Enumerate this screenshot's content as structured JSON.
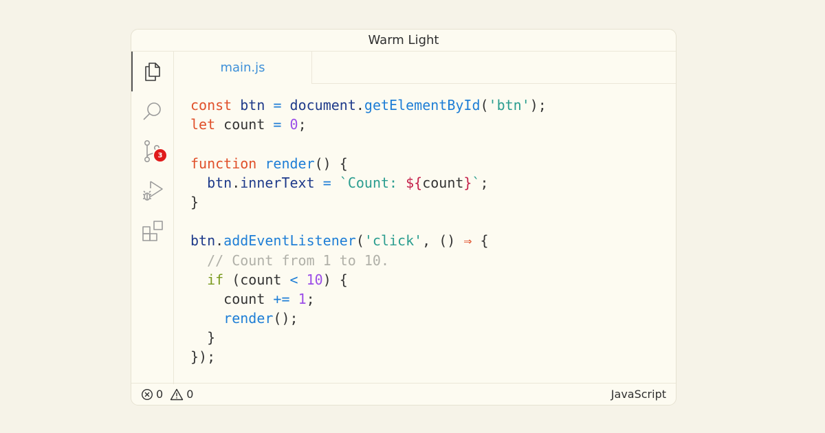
{
  "window": {
    "title": "Warm Light"
  },
  "tabs": [
    {
      "label": "main.js",
      "active": true
    }
  ],
  "activity_bar": {
    "items": [
      {
        "icon": "files-icon",
        "active": true
      },
      {
        "icon": "search-icon",
        "active": false
      },
      {
        "icon": "source-control-icon",
        "active": false,
        "badge": "3"
      },
      {
        "icon": "run-debug-icon",
        "active": false
      },
      {
        "icon": "extensions-icon",
        "active": false
      }
    ]
  },
  "code": {
    "language": "javascript",
    "lines": [
      [
        [
          "kw",
          "const"
        ],
        [
          "p",
          " "
        ],
        [
          "var",
          "btn"
        ],
        [
          "p",
          " "
        ],
        [
          "op",
          "="
        ],
        [
          "p",
          " "
        ],
        [
          "var",
          "document"
        ],
        [
          "p",
          "."
        ],
        [
          "fn",
          "getElementById"
        ],
        [
          "p",
          "("
        ],
        [
          "str",
          "'btn'"
        ],
        [
          "p",
          ");"
        ]
      ],
      [
        [
          "kw",
          "let"
        ],
        [
          "p",
          " count "
        ],
        [
          "op",
          "="
        ],
        [
          "p",
          " "
        ],
        [
          "num",
          "0"
        ],
        [
          "p",
          ";"
        ]
      ],
      [],
      [
        [
          "kw",
          "function"
        ],
        [
          "p",
          " "
        ],
        [
          "fn",
          "render"
        ],
        [
          "p",
          "() {"
        ]
      ],
      [
        [
          "p",
          "  "
        ],
        [
          "var",
          "btn"
        ],
        [
          "p",
          "."
        ],
        [
          "var",
          "innerText"
        ],
        [
          "p",
          " "
        ],
        [
          "op",
          "="
        ],
        [
          "p",
          " "
        ],
        [
          "str",
          "`Count: "
        ],
        [
          "interp",
          "${"
        ],
        [
          "p",
          "count"
        ],
        [
          "interp",
          "}"
        ],
        [
          "str",
          "`"
        ],
        [
          "p",
          ";"
        ]
      ],
      [
        [
          "p",
          "}"
        ]
      ],
      [],
      [
        [
          "var",
          "btn"
        ],
        [
          "p",
          "."
        ],
        [
          "fn",
          "addEventListener"
        ],
        [
          "p",
          "("
        ],
        [
          "str",
          "'click'"
        ],
        [
          "p",
          ", () "
        ],
        [
          "arrow",
          "⇒"
        ],
        [
          "p",
          " {"
        ]
      ],
      [
        [
          "p",
          "  "
        ],
        [
          "comment",
          "// Count from 1 to 10."
        ]
      ],
      [
        [
          "p",
          "  "
        ],
        [
          "if",
          "if"
        ],
        [
          "p",
          " (count "
        ],
        [
          "op",
          "<"
        ],
        [
          "p",
          " "
        ],
        [
          "num",
          "10"
        ],
        [
          "p",
          ") {"
        ]
      ],
      [
        [
          "p",
          "    count "
        ],
        [
          "op",
          "+="
        ],
        [
          "p",
          " "
        ],
        [
          "num",
          "1"
        ],
        [
          "p",
          ";"
        ]
      ],
      [
        [
          "p",
          "    "
        ],
        [
          "fn",
          "render"
        ],
        [
          "p",
          "();"
        ]
      ],
      [
        [
          "p",
          "  }"
        ]
      ],
      [
        [
          "p",
          "});"
        ]
      ]
    ]
  },
  "status_bar": {
    "errors": "0",
    "warnings": "0",
    "language": "JavaScript"
  },
  "colors": {
    "background": "#f6f3e8",
    "window": "#fdfbf1",
    "keyword": "#e0502a",
    "function": "#1e7ed6",
    "string": "#2a9d8f",
    "number": "#9b4de8",
    "comment": "#b0b0a8",
    "badge": "#e01b1b"
  }
}
